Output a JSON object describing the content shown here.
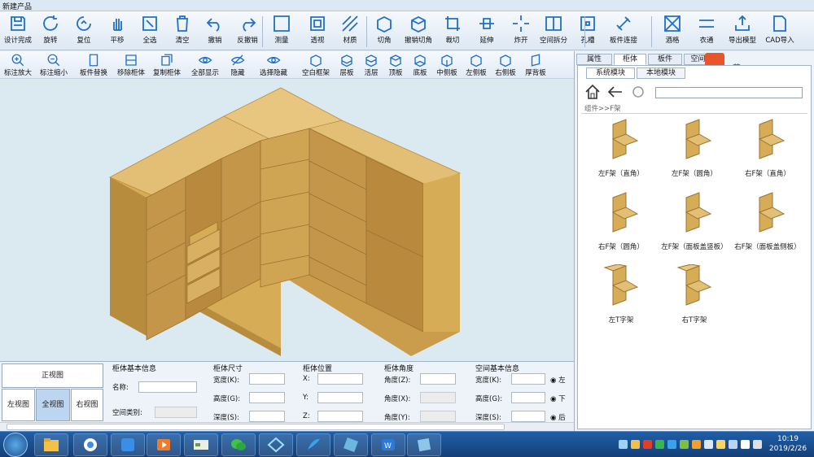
{
  "window": {
    "title": "新建产品"
  },
  "toolbar1": [
    {
      "label": "设计完成",
      "icon": "save-icon"
    },
    {
      "label": "旋转",
      "icon": "rotate-icon"
    },
    {
      "label": "复位",
      "icon": "reset-icon"
    },
    {
      "label": "平移",
      "icon": "hand-icon"
    },
    {
      "label": "全选",
      "icon": "select-all-icon"
    },
    {
      "label": "清空",
      "icon": "trash-icon"
    },
    {
      "label": "撤销",
      "icon": "undo-icon"
    },
    {
      "label": "反撤销",
      "icon": "redo-icon"
    },
    {
      "label": "测量",
      "icon": "measure-icon"
    },
    {
      "label": "透视",
      "icon": "perspective-icon"
    },
    {
      "label": "材质",
      "icon": "material-icon"
    },
    {
      "label": "切角",
      "icon": "chamfer-icon"
    },
    {
      "label": "撤销切角",
      "icon": "undo-chamfer-icon"
    },
    {
      "label": "裁切",
      "icon": "cut-icon"
    },
    {
      "label": "延伸",
      "icon": "extend-icon"
    },
    {
      "label": "炸开",
      "icon": "explode-icon"
    },
    {
      "label": "空间拆分",
      "icon": "space-split-icon"
    },
    {
      "label": "孔槽",
      "icon": "hole-slot-icon"
    },
    {
      "label": "板件连接",
      "icon": "panel-connect-icon"
    },
    {
      "label": "酒格",
      "icon": "wine-rack-icon"
    },
    {
      "label": "衣通",
      "icon": "hanger-rail-icon"
    },
    {
      "label": "导出模型",
      "icon": "export-model-icon"
    },
    {
      "label": "CAD导入",
      "icon": "cad-import-icon"
    }
  ],
  "toolbar2": [
    {
      "label": "标注放大",
      "icon": "zoom-in-icon"
    },
    {
      "label": "标注缩小",
      "icon": "zoom-out-icon"
    },
    {
      "label": "板件替换",
      "icon": "panel-replace-icon"
    },
    {
      "label": "移除柜体",
      "icon": "remove-cabinet-icon"
    },
    {
      "label": "复制柜体",
      "icon": "copy-cabinet-icon"
    },
    {
      "label": "全部显示",
      "icon": "eye-icon"
    },
    {
      "label": "隐藏",
      "icon": "hide-icon"
    },
    {
      "label": "选择隐藏",
      "icon": "select-hide-icon"
    },
    {
      "label": "空白框架",
      "icon": "blank-frame-icon"
    },
    {
      "label": "层板",
      "icon": "shelf-icon"
    },
    {
      "label": "活层",
      "icon": "movable-shelf-icon"
    },
    {
      "label": "顶板",
      "icon": "top-panel-icon"
    },
    {
      "label": "底板",
      "icon": "bottom-panel-icon"
    },
    {
      "label": "中侧板",
      "icon": "middle-side-icon"
    },
    {
      "label": "左侧板",
      "icon": "left-side-icon"
    },
    {
      "label": "右侧板",
      "icon": "right-side-icon"
    },
    {
      "label": "厚背板",
      "icon": "thick-back-icon"
    }
  ],
  "panel": {
    "tabs": [
      "属性",
      "柜体",
      "板件",
      "空间树"
    ],
    "active_tab": "柜体",
    "subtabs": [
      "系统模块",
      "本地模块"
    ],
    "breadcrumb": "组件>>F架",
    "search_placeholder": "",
    "items": [
      "左F架（直角）",
      "左F架（圆角）",
      "右F架（直角）",
      "右F架（圆角）",
      "左F架（面板盖竖板）",
      "右F架（面板盖侧板）",
      "左T字架",
      "右T字架"
    ]
  },
  "ime": {
    "label": "英"
  },
  "bottom": {
    "views": {
      "front": "正视图",
      "left": "左视图",
      "full": "全视图",
      "right": "右视图"
    },
    "basic": {
      "title": "柜体基本信息",
      "name_label": "名称:",
      "space_type_label": "空间类别:"
    },
    "size": {
      "title": "柜体尺寸",
      "width_label": "宽度(K):",
      "height_label": "高度(G):",
      "depth_label": "深度(S):"
    },
    "position": {
      "title": "柜体位置",
      "x_label": "X:",
      "y_label": "Y:",
      "z_label": "Z:"
    },
    "angle": {
      "title": "柜体角度",
      "z_label": "角度(Z):",
      "x_label": "角度(X):",
      "y_label": "角度(Y):"
    },
    "space": {
      "title": "空间基本信息",
      "width_label": "宽度(K):",
      "height_label": "高度(G):",
      "depth_label": "深度(S):",
      "r1": "左",
      "r2": "下",
      "r3": "后"
    }
  },
  "clock": {
    "time": "10:19",
    "date": "2019/2/26"
  },
  "colors": {
    "wood_top": "#e2bf75",
    "wood_front": "#d7ac57",
    "wood_side": "#b88c3d",
    "wood_inner": "#c99d4c",
    "viewport_bg": "#dbe9f0"
  }
}
